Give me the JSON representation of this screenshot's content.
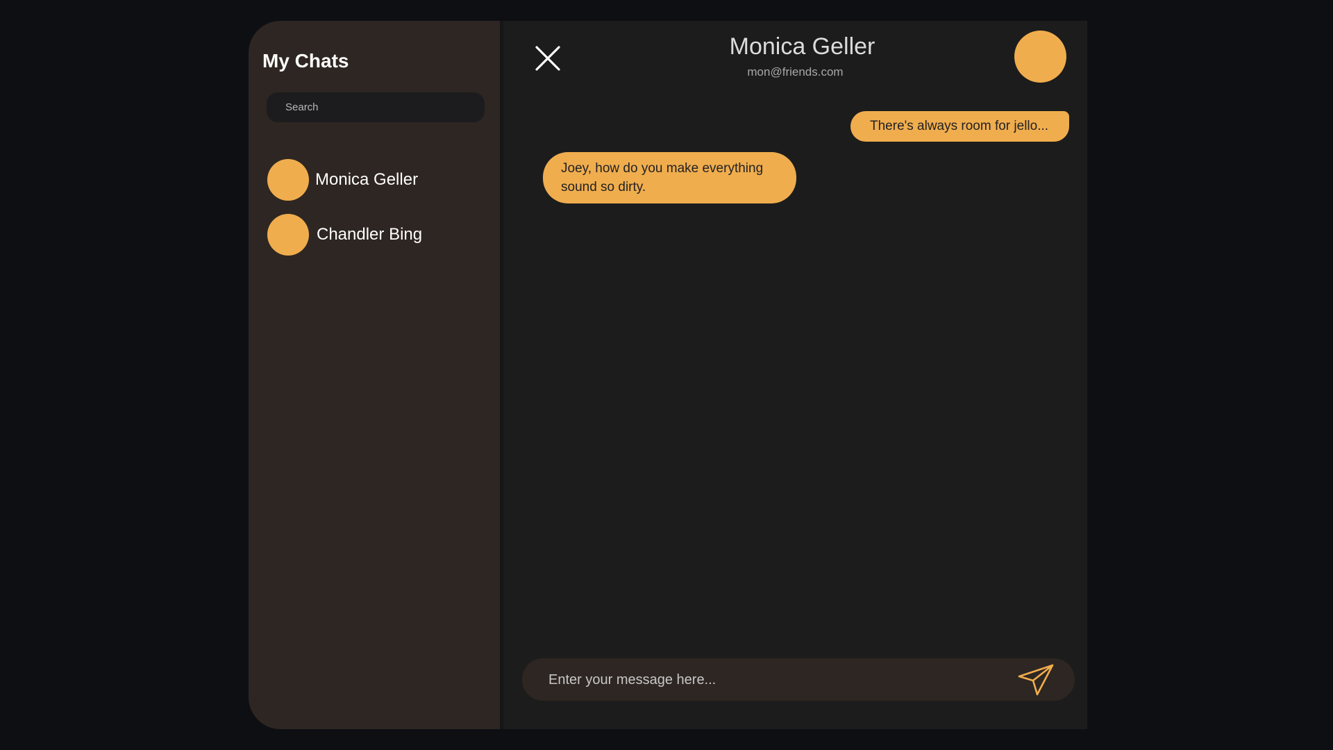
{
  "sidebar": {
    "title": "My Chats",
    "search_placeholder": "Search",
    "chats": [
      {
        "name": "Monica Geller"
      },
      {
        "name": "Chandler Bing"
      }
    ]
  },
  "header": {
    "name": "Monica Geller",
    "email": "mon@friends.com"
  },
  "messages": [
    {
      "direction": "sent",
      "text": "There's always room for jello..."
    },
    {
      "direction": "received",
      "text": "Joey, how do you make everything sound so dirty."
    }
  ],
  "composer": {
    "placeholder": "Enter your message here..."
  },
  "icons": {
    "close": "close-icon",
    "send": "send-icon"
  },
  "colors": {
    "accent": "#f0ad4e",
    "page_background": "#0e0f13",
    "sidebar_background": "#2e2622",
    "chat_background": "#1c1c1c"
  }
}
